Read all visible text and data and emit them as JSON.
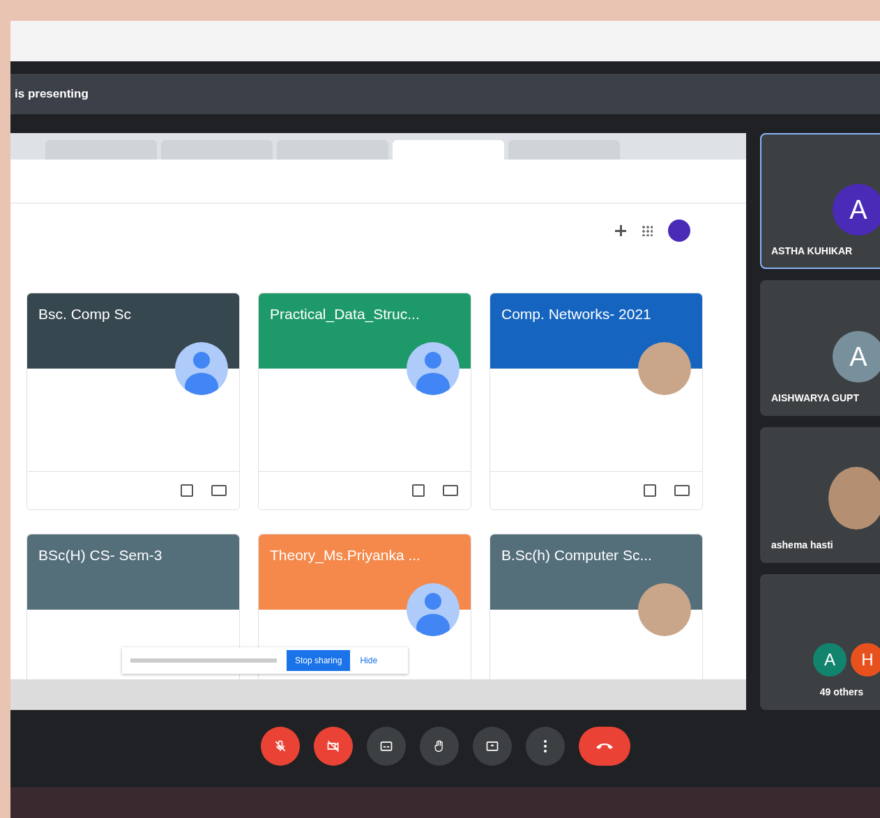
{
  "presenter_bar": {
    "text": "is presenting"
  },
  "shared_screen": {
    "browser_tabs": [
      {
        "selected": false
      },
      {
        "selected": false
      },
      {
        "selected": false
      },
      {
        "selected": true
      },
      {
        "selected": false
      }
    ],
    "classes": [
      {
        "kind": "generic",
        "title": "Bsc. Comp Sc",
        "color": "#37474f"
      },
      {
        "kind": "generic",
        "title": "Practical_Data_Struc...",
        "color": "#1e9a6a"
      },
      {
        "kind": "photo",
        "title": "Comp. Networks- 2021",
        "color": "#1565c0"
      },
      {
        "kind": "plain",
        "title": "BSc(H) CS- Sem-3",
        "color": "#546e7a"
      },
      {
        "kind": "generic",
        "title": "Theory_Ms.Priyanka ...",
        "color": "#f4894b"
      },
      {
        "kind": "photo",
        "title": "B.Sc(h) Computer Sc...",
        "color": "#546e7a"
      }
    ],
    "share_banner": {
      "button": "Stop sharing",
      "link": "Hide"
    }
  },
  "participants": [
    {
      "kind": "initial",
      "name": "ASTHA KUHIKAR",
      "initial": "A",
      "color": "#4a2bb8",
      "selected": true
    },
    {
      "kind": "initial",
      "name": "AISHWARYA GUPT",
      "initial": "A",
      "color": "#78909c",
      "selected": false
    },
    {
      "kind": "photo",
      "name": "ashema hasti",
      "selected": false
    },
    {
      "kind": "group",
      "label": "49 others",
      "avatars": [
        {
          "initial": "A",
          "color": "#12846e"
        },
        {
          "initial": "H",
          "color": "#e8511e"
        }
      ],
      "selected": false
    }
  ],
  "controls": [
    {
      "kind": "mic",
      "on": false
    },
    {
      "kind": "camera",
      "on": false
    },
    {
      "kind": "captions",
      "on": false
    },
    {
      "kind": "hand",
      "on": false
    },
    {
      "kind": "present",
      "on": false
    },
    {
      "kind": "more",
      "on": false
    },
    {
      "kind": "end"
    }
  ]
}
